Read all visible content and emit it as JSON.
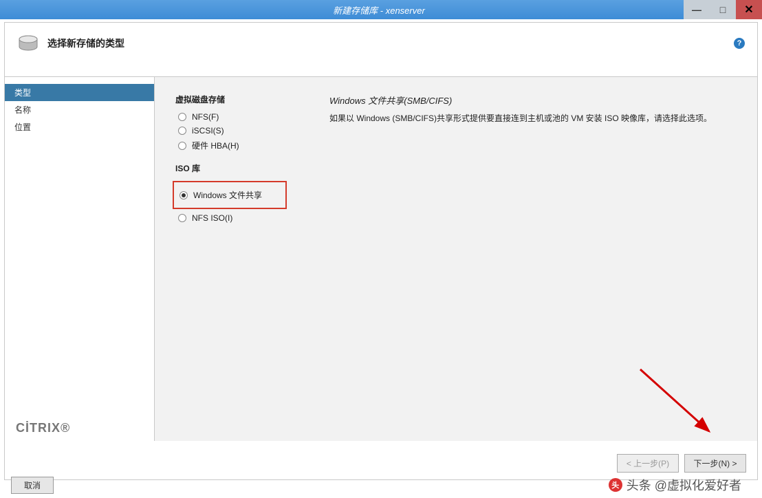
{
  "titlebar": {
    "title": "新建存储库 - xenserver"
  },
  "banner": {
    "heading": "选择新存储的类型"
  },
  "sidebar": {
    "steps": [
      {
        "label": "类型",
        "active": true
      },
      {
        "label": "名称",
        "active": false
      },
      {
        "label": "位置",
        "active": false
      }
    ]
  },
  "content": {
    "group1_title": "虚拟磁盘存储",
    "radios_vdisk": [
      {
        "label": "NFS(F)",
        "selected": false
      },
      {
        "label": "iSCSI(S)",
        "selected": false
      },
      {
        "label": "硬件 HBA(H)",
        "selected": false
      }
    ],
    "group2_title": "ISO 库",
    "radio_win_share": {
      "label": "Windows 文件共享",
      "selected": true
    },
    "radio_nfs_iso": {
      "label": "NFS ISO(I)",
      "selected": false
    },
    "desc_title": "Windows 文件共享(SMB/CIFS)",
    "desc_body": "如果以 Windows (SMB/CIFS)共享形式提供要直接连到主机或池的 VM 安装 ISO 映像库，请选择此选项。"
  },
  "buttons": {
    "prev": "< 上一步(P)",
    "next": "下一步(N) >",
    "cancel": "取消"
  },
  "branding": {
    "citrix": "CİTRIX"
  },
  "watermark": {
    "label": "头条 @虚拟化爱好者",
    "logo_text": "头"
  }
}
